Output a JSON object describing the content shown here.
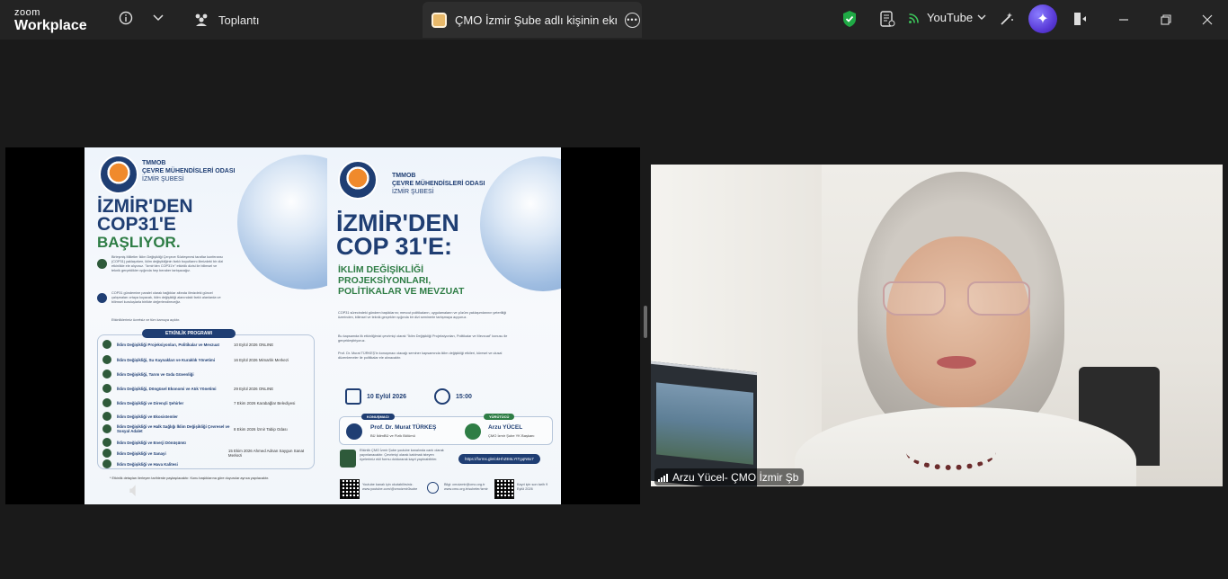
{
  "app": {
    "brand_top": "zoom",
    "brand_bottom": "Workplace"
  },
  "titlebar": {
    "info_icon": "info-icon",
    "dropdown_icon": "chevron-down-icon",
    "meeting_tab_label": "Toplantı",
    "share_tab_label": "ÇMO İzmir Şube adlı kişinin ekranı",
    "more_label": "•••",
    "youtube_label": "YouTube"
  },
  "poster_left": {
    "org_line1": "TMMOB",
    "org_line2": "ÇEVRE MÜHENDİSLERİ ODASI",
    "org_line3": "İZMİR ŞUBESİ",
    "headline1": "İZMİR'DEN",
    "headline2": "COP31'E",
    "headline3": "BAŞLIYOR.",
    "para1": "Birleşmiş Milletler İklim Değişikliği Çerçeve Sözleşmesi taraflar konferansı (COP31) yaklaşırken, iklim değişikliğinin farklı boyutlarını ilimizdeki bir dizi etkinlikle ele alıyoruz. \"İzmir'den COP31'e\" etkinlik dizisi ile bilimsel ve teknik gerçeklikler ışığında hep beraber tartışacağız.",
    "para2": "COP31 gündemine paralel olarak bağlıklar altında ilimizdeki güncel çalışmaları ortaya koyacak, iklim değişikliği alanındaki farklı alanlarda ve bilimsel kuruluşlarla birlikte değerlendireceğiz.",
    "para3": "Etkinliklerimiz ücretsiz ve tüm kamuya açıktır.",
    "program_title": "ETKİNLİK PROGRAMI",
    "program": [
      {
        "label": "İklim Değişikliği Projeksiyonları, Politikalar ve Mevzuat",
        "date": "10 Eylül 2026 ONLINE"
      },
      {
        "label": "İklim Değişikliği, Su Kaynakları ve Kuraklık Yönetimi",
        "date": "16 Eylül 2026 Mimarlık Merkezi"
      },
      {
        "label": "İklim Değişikliği, Tarım ve Gıda Güvenliği",
        "date": ""
      },
      {
        "label": "İklim Değişikliği, Döngüsel Ekonomi ve Atık Yönetimi",
        "date": "29 Eylül 2026 ONLINE"
      },
      {
        "label": "İklim Değişikliği ve Dirençli Şehirler",
        "date": "7 Ekim 2026 Karabağlar Belediyesi"
      },
      {
        "label": "İklim Değişikliği ve Ekosistemler",
        "date": ""
      },
      {
        "label": "İklim Değişikliği ve Halk Sağlığı İklim Değişikliği Çevresel ve Sosyal Adalet",
        "date": "8 Ekim 2026 İzmir Tabip Odası"
      },
      {
        "label": "İklim Değişikliği ve Enerji Dönüşümü",
        "date": ""
      },
      {
        "label": "İklim Değişikliği ve Sanayi",
        "date": "15 Ekim 2026 Ahmed Adnan Saygun Sanat Merkezi"
      },
      {
        "label": "İklim Değişikliği ve Hava Kalitesi",
        "date": ""
      }
    ],
    "footnote": "* Etkinlik detayları ilerleyen tarihlerde paylaşılacaktır. Konu başlıklarına göre duyurular ayrıca yapılacaktır."
  },
  "poster_right": {
    "org_line1": "TMMOB",
    "org_line2": "ÇEVRE MÜHENDİSLERİ ODASI",
    "org_line3": "İZMİR ŞUBESİ",
    "headline1": "İZMİR'DEN",
    "headline2": "COP 31'E:",
    "sub1": "İKLİM DEĞİŞİKLİĞİ",
    "sub2": "PROJEKSİYONLARI,",
    "sub3": "POLİTİKALAR VE MEVZUAT",
    "para1": "COP31 sürecindeki gündem başlıklarını; mevcut politikaların, uygulamaların ve çözüm yaklaşımlarının yeterliliği üzerinden, bilimsel ve teknik gerçekler ışığında bir dizi seminerle tartışmaya açıyoruz.",
    "para2": "Bu kapsamda ilk etkinliğimizi çevrimiçi olarak \"İklim Değişikliği Projeksiyonları, Politikalar ve Mevzuat\" konusu ile gerçekleştiriyoruz.",
    "para3": "Prof. Dr. Murat TÜRKEŞ'in konuşmacı olacağı seminer kapsamında iklim değişikliği etkileri, küresel ve ulusal düzenlemeler ile politikalar ele alınacaktır.",
    "date": "10 Eylül 2026",
    "time": "15:00",
    "speaker_tag": "KONUŞMACI",
    "speaker_name": "Prof. Dr. Murat TÜRKEŞ",
    "speaker_affil": "BÜ İklimBÜ ve Fizik Bölümü",
    "moderator_tag": "YÜRÜTÜCÜ",
    "moderator_name": "Arzu YÜCEL",
    "moderator_affil": "ÇMO İzmir Şube YK Başkanı",
    "register_text": "Etkinlik ÇMO İzmir Şube youtube kanalında canlı olarak yayınlanacaktır. Çevrimiçi olarak katılmak isteyen üyelerimiz ekli formu doldurarak kayıt yaptırabilirler.",
    "form_url": "https://forms.gle/okHhZE6LYtTgqN6x7",
    "youtube_note": "Youtube kanalı için okutabilirsiniz. www.youtube.com/@cmoizmir3sube",
    "contact": "Bilgi: cmoizmir@cmo.org.tr www.cmo.org.tr/subeler/izmir",
    "deadline": "Kayıt için son tarih 9 Eylül 2026"
  },
  "video": {
    "participant_name": "Arzu Yücel- ÇMO İzmir Şb"
  },
  "colors": {
    "accent_navy": "#1f3e73",
    "accent_green": "#2e7d45",
    "logo_orange": "#f08a2c"
  }
}
